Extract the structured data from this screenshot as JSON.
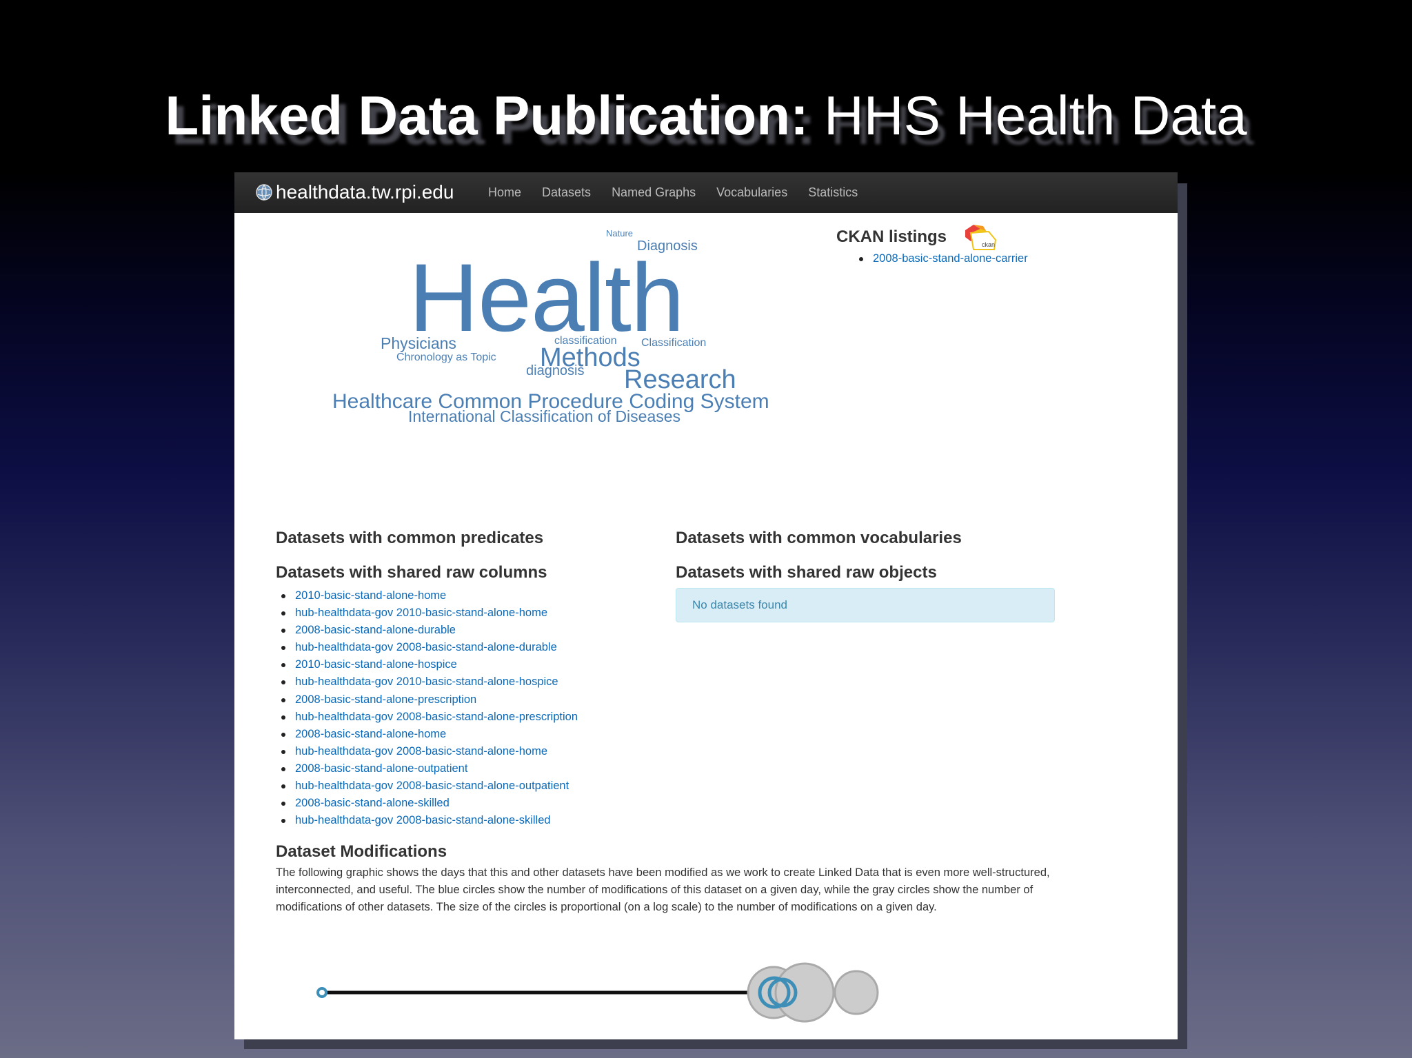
{
  "slide": {
    "title_bold": "Linked Data Publication:",
    "title_rest": " HHS Health Data"
  },
  "navbar": {
    "brand": "healthdata.tw.rpi.edu",
    "items": [
      "Home",
      "Datasets",
      "Named Graphs",
      "Vocabularies",
      "Statistics"
    ]
  },
  "tag_cloud": [
    "Nature",
    "Diagnosis",
    "Health",
    "Physicians",
    "classification",
    "Classification",
    "Chronology as Topic",
    "Methods",
    "diagnosis",
    "Research",
    "Healthcare Common Procedure Coding System",
    "International Classification of Diseases"
  ],
  "ckan": {
    "title": "CKAN listings",
    "logo_text": "ckan",
    "items": [
      "2008-basic-stand-alone-carrier"
    ]
  },
  "sections": {
    "common_predicates": "Datasets with common predicates",
    "common_vocabularies": "Datasets with common vocabularies",
    "shared_raw_columns": "Datasets with shared raw columns",
    "shared_raw_objects": "Datasets with shared raw objects",
    "no_datasets": "No datasets found",
    "modifications": "Dataset Modifications"
  },
  "shared_raw_columns": [
    "2010-basic-stand-alone-home",
    "hub-healthdata-gov 2010-basic-stand-alone-home",
    "2008-basic-stand-alone-durable",
    "hub-healthdata-gov 2008-basic-stand-alone-durable",
    "2010-basic-stand-alone-hospice",
    "hub-healthdata-gov 2010-basic-stand-alone-hospice",
    "2008-basic-stand-alone-prescription",
    "hub-healthdata-gov 2008-basic-stand-alone-prescription",
    "2008-basic-stand-alone-home",
    "hub-healthdata-gov 2008-basic-stand-alone-home",
    "2008-basic-stand-alone-outpatient",
    "hub-healthdata-gov 2008-basic-stand-alone-outpatient",
    "2008-basic-stand-alone-skilled",
    "hub-healthdata-gov 2008-basic-stand-alone-skilled"
  ],
  "modifications_text": "The following graphic shows the days that this and other datasets have been modified as we work to create Linked Data that is even more well-structured, interconnected, and useful. The blue circles show the number of modifications of this dataset on a given day, while the gray circles show the number of modifications of other datasets. The size of the circles is proportional (on a log scale) to the number of modifications on a given day.",
  "colors": {
    "link": "#0a69b8",
    "tag": "#4b7fb4",
    "timeline_blue": "#3d8fb8",
    "timeline_gray": "#cccccc"
  }
}
